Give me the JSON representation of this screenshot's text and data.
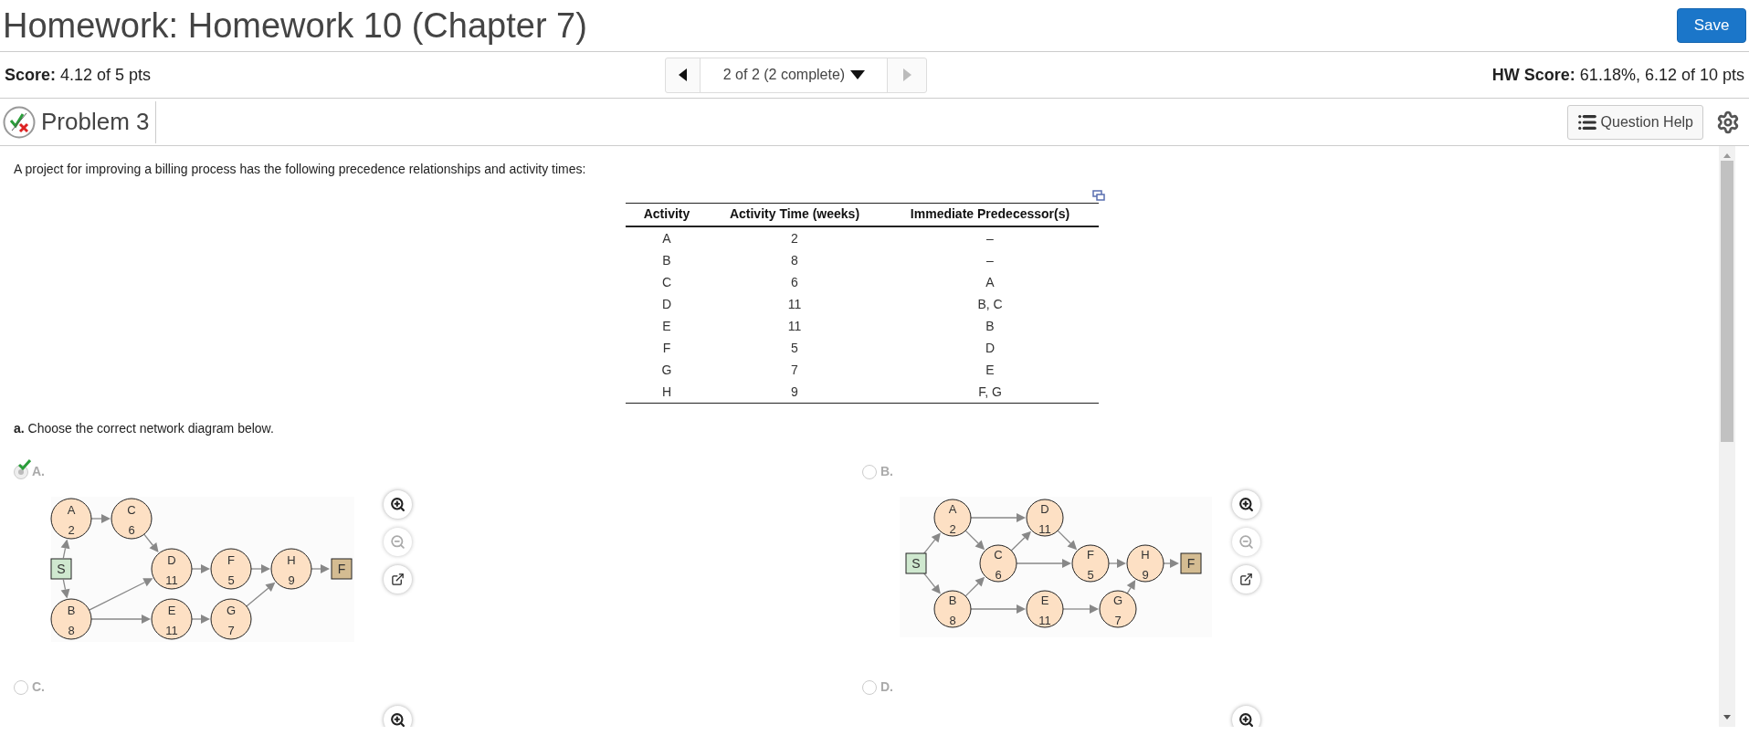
{
  "header": {
    "title": "Homework: Homework 10 (Chapter 7)",
    "save_button": "Save"
  },
  "score_bar": {
    "score_label": "Score:",
    "score_value": "4.12 of 5 pts",
    "nav": {
      "prev_disabled": false,
      "position": "2 of 2 (2 complete)",
      "next_disabled": true
    },
    "hw_score_label": "HW Score:",
    "hw_score_value": "61.18%, 6.12 of 10 pts"
  },
  "problem_bar": {
    "title": "Problem 3",
    "question_help": "Question Help"
  },
  "question": {
    "intro": "A project for improving a billing process has the following precedence relationships and activity times:",
    "table": {
      "columns": [
        "Activity",
        "Activity Time (weeks)",
        "Immediate Predecessor(s)"
      ],
      "rows": [
        [
          "A",
          "2",
          "–"
        ],
        [
          "B",
          "8",
          "–"
        ],
        [
          "C",
          "6",
          "A"
        ],
        [
          "D",
          "11",
          "B, C"
        ],
        [
          "E",
          "11",
          "B"
        ],
        [
          "F",
          "5",
          "D"
        ],
        [
          "G",
          "7",
          "E"
        ],
        [
          "H",
          "9",
          "F, G"
        ]
      ]
    },
    "part_a": "**a.** Choose the correct network diagram below.",
    "options": [
      {
        "letter": "A.",
        "selected": true,
        "correct": true,
        "nodes": [
          {
            "kind": "start",
            "label": "S"
          },
          {
            "kind": "activity",
            "label": "A",
            "time": "2"
          },
          {
            "kind": "activity",
            "label": "C",
            "time": "6"
          },
          {
            "kind": "activity",
            "label": "B",
            "time": "8"
          },
          {
            "kind": "activity",
            "label": "D",
            "time": "11"
          },
          {
            "kind": "activity",
            "label": "E",
            "time": "11"
          },
          {
            "kind": "activity",
            "label": "F",
            "time": "5"
          },
          {
            "kind": "activity",
            "label": "G",
            "time": "7"
          },
          {
            "kind": "activity",
            "label": "H",
            "time": "9"
          },
          {
            "kind": "finish",
            "label": "F"
          }
        ]
      },
      {
        "letter": "B.",
        "selected": false,
        "correct": false,
        "nodes": [
          {
            "kind": "start",
            "label": "S"
          },
          {
            "kind": "activity",
            "label": "A",
            "time": "2"
          },
          {
            "kind": "activity",
            "label": "D",
            "time": "11"
          },
          {
            "kind": "activity",
            "label": "C",
            "time": "6"
          },
          {
            "kind": "activity",
            "label": "F",
            "time": "5"
          },
          {
            "kind": "activity",
            "label": "H",
            "time": "9"
          },
          {
            "kind": "finish",
            "label": "F"
          },
          {
            "kind": "activity",
            "label": "B",
            "time": "8"
          },
          {
            "kind": "activity",
            "label": "E",
            "time": "11"
          },
          {
            "kind": "activity",
            "label": "G",
            "time": "7"
          }
        ]
      },
      {
        "letter": "C.",
        "selected": false,
        "correct": false
      },
      {
        "letter": "D.",
        "selected": false,
        "correct": false
      }
    ]
  }
}
